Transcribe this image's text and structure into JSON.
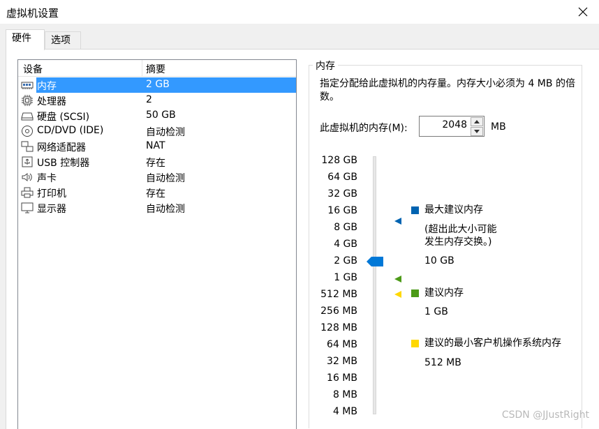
{
  "window": {
    "title": "虚拟机设置"
  },
  "tabs": [
    {
      "label": "硬件",
      "active": true
    },
    {
      "label": "选项",
      "active": false
    }
  ],
  "device_list": {
    "columns": [
      "设备",
      "摘要"
    ],
    "rows": [
      {
        "icon": "memory-icon",
        "name": "内存",
        "summary": "2 GB",
        "selected": true
      },
      {
        "icon": "processor-icon",
        "name": "处理器",
        "summary": "2",
        "selected": false
      },
      {
        "icon": "harddisk-icon",
        "name": "硬盘 (SCSI)",
        "summary": "50 GB",
        "selected": false
      },
      {
        "icon": "cd-dvd-icon",
        "name": "CD/DVD (IDE)",
        "summary": "自动检测",
        "selected": false
      },
      {
        "icon": "network-adapter-icon",
        "name": "网络适配器",
        "summary": "NAT",
        "selected": false
      },
      {
        "icon": "usb-controller-icon",
        "name": "USB 控制器",
        "summary": "存在",
        "selected": false
      },
      {
        "icon": "sound-card-icon",
        "name": "声卡",
        "summary": "自动检测",
        "selected": false
      },
      {
        "icon": "printer-icon",
        "name": "打印机",
        "summary": "存在",
        "selected": false
      },
      {
        "icon": "display-icon",
        "name": "显示器",
        "summary": "自动检测",
        "selected": false
      }
    ]
  },
  "memory": {
    "group_title": "内存",
    "description": "指定分配给此虚拟机的内存量。内存大小必须为 4 MB 的倍数。",
    "field_label": "此虚拟机的内存(M):",
    "value": "2048",
    "unit": "MB",
    "scale_ticks": [
      "128 GB",
      "64 GB",
      "32 GB",
      "16 GB",
      "8 GB",
      "4 GB",
      "2 GB",
      "1 GB",
      "512 MB",
      "256 MB",
      "128 MB",
      "64 MB",
      "32 MB",
      "16 MB",
      "8 MB",
      "4 MB"
    ],
    "slider_value": "2 GB",
    "legend": {
      "max": {
        "title": "最大建议内存",
        "note_line1": "(超出此大小可能",
        "note_line2": "发生内存交换。)",
        "value": "10 GB",
        "color": "#0063b1"
      },
      "recommended": {
        "title": "建议内存",
        "value": "1 GB",
        "color": "#4c9a18"
      },
      "min_guest": {
        "title": "建议的最小客户机操作系统内存",
        "value": "512 MB",
        "color": "#ffd800"
      }
    }
  },
  "watermark": "CSDN @JJustRight"
}
